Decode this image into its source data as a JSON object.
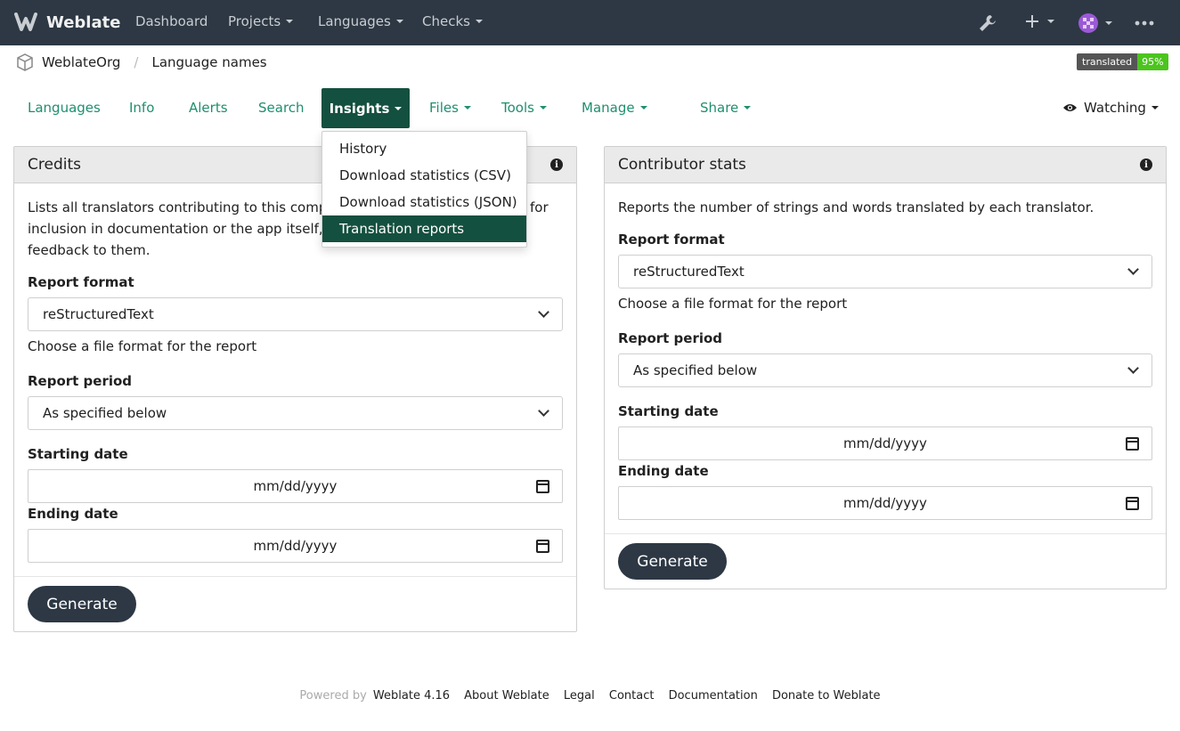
{
  "navbar": {
    "brand": "Weblate",
    "items": [
      {
        "label": "Dashboard",
        "caret": false
      },
      {
        "label": "Projects",
        "caret": true
      },
      {
        "label": "Languages",
        "caret": true
      },
      {
        "label": "Checks",
        "caret": true
      }
    ]
  },
  "breadcrumb": {
    "project": "WeblateOrg",
    "component": "Language names"
  },
  "badge": {
    "label": "translated",
    "value": "95%"
  },
  "tabs": {
    "languages": "Languages",
    "info": "Info",
    "alerts": "Alerts",
    "search": "Search",
    "insights": "Insights",
    "files": "Files",
    "tools": "Tools",
    "manage": "Manage",
    "share": "Share",
    "watching": "Watching"
  },
  "dropdown": {
    "items": [
      "History",
      "Download statistics (CSV)",
      "Download statistics (JSON)",
      "Translation reports"
    ],
    "active_index": 3
  },
  "credits": {
    "title": "Credits",
    "description_line1": "Lists all translators contributing to this compon",
    "description_line1_end": "for",
    "description_line2": "inclusion in documentation or the app itself, to t",
    "description_line3": "feedback to them.",
    "format_label": "Report format",
    "format_value": "reStructuredText",
    "format_help": "Choose a file format for the report",
    "period_label": "Report period",
    "period_value": "As specified below",
    "start_label": "Starting date",
    "start_placeholder": "mm/dd/yyyy",
    "end_label": "Ending date",
    "end_placeholder": "mm/dd/yyyy",
    "generate": "Generate"
  },
  "contrib": {
    "title": "Contributor stats",
    "description": "Reports the number of strings and words translated by each translator.",
    "format_label": "Report format",
    "format_value": "reStructuredText",
    "format_help": "Choose a file format for the report",
    "period_label": "Report period",
    "period_value": "As specified below",
    "start_label": "Starting date",
    "start_placeholder": "mm/dd/yyyy",
    "end_label": "Ending date",
    "end_placeholder": "mm/dd/yyyy",
    "generate": "Generate"
  },
  "footer": {
    "powered_by": "Powered by",
    "version": "Weblate 4.16",
    "links": [
      "About Weblate",
      "Legal",
      "Contact",
      "Documentation",
      "Donate to Weblate"
    ]
  },
  "colors": {
    "navbar": "#2d3844",
    "accent": "#1f8f6f",
    "active_tab": "#14503f",
    "badge_value": "#4bc51d"
  }
}
